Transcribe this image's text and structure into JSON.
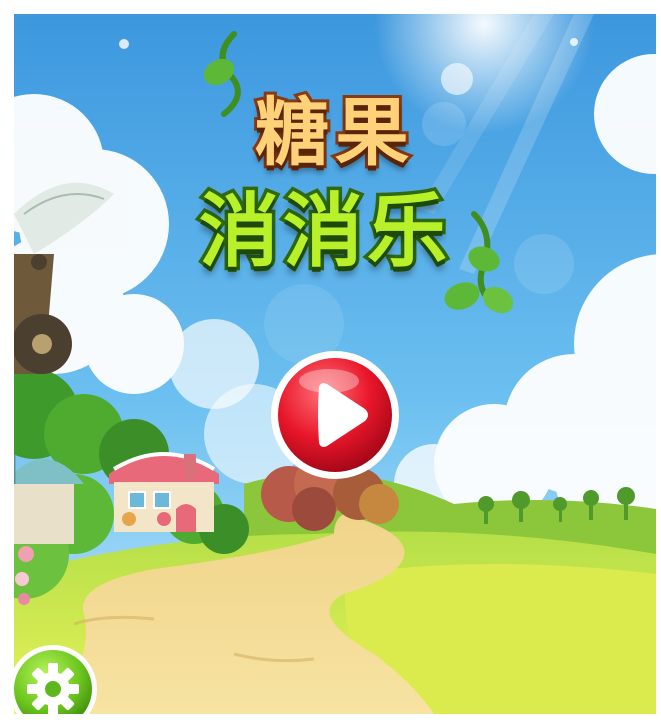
{
  "game": {
    "title_line1": "糖果",
    "title_line2": "消消乐"
  },
  "controls": {
    "play": "play-icon",
    "settings": "gear-icon"
  },
  "colors": {
    "sky": "#4aa8e6",
    "title_orange": "#ffd27a",
    "title_green": "#b8f02a",
    "play_red": "#e8162a",
    "settings_green": "#6cc61e"
  }
}
